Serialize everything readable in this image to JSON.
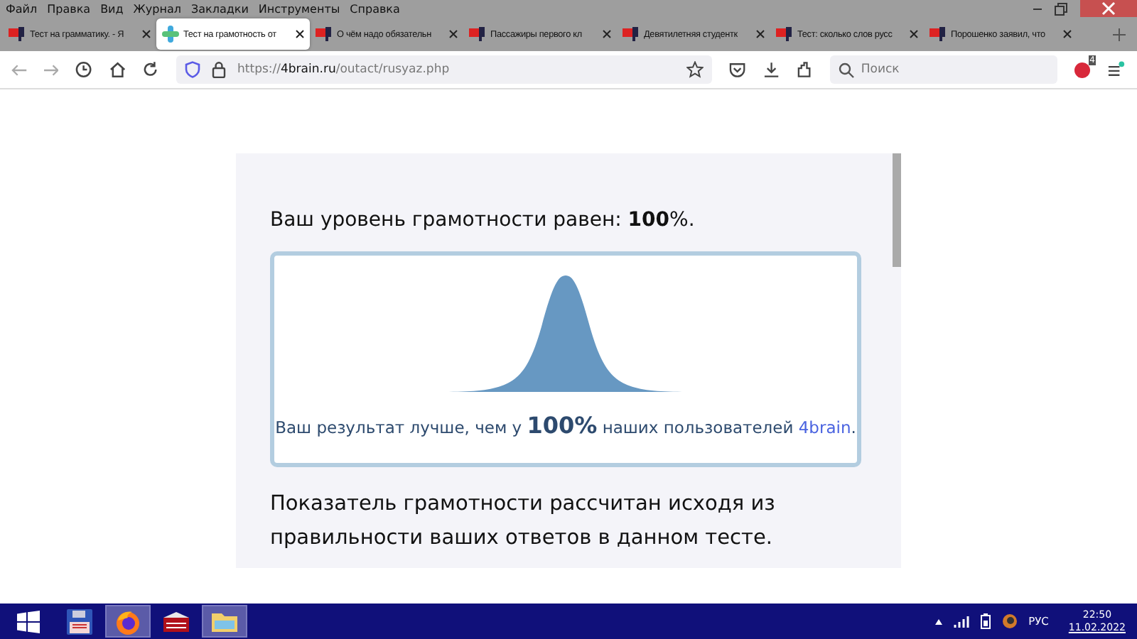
{
  "menu_bar": [
    "Файл",
    "Правка",
    "Вид",
    "Журнал",
    "Закладки",
    "Инструменты",
    "Справка"
  ],
  "tabs": [
    {
      "title": "Тест на грамматику. - Я",
      "selected": false,
      "kind": "site"
    },
    {
      "title": "Тест на грамотность от",
      "selected": true,
      "kind": "brain"
    },
    {
      "title": "О чём надо обязательн",
      "selected": false,
      "kind": "site"
    },
    {
      "title": "Пассажиры первого кл",
      "selected": false,
      "kind": "site"
    },
    {
      "title": "Девятилетняя студентк",
      "selected": false,
      "kind": "site"
    },
    {
      "title": "Тест: сколько слов русс",
      "selected": false,
      "kind": "site"
    },
    {
      "title": "Порошенко заявил, что",
      "selected": false,
      "kind": "site"
    }
  ],
  "address_bar": {
    "scheme": "https://",
    "domain": "4brain.ru",
    "path": "/outact/rusyaz.php"
  },
  "search": {
    "placeholder": "Поиск"
  },
  "extension_badge": "4",
  "page": {
    "heading": "Ваш уровень грамотности равен: **100**%.",
    "result": {
      "before": "Ваш результат лучше, чем у ",
      "value": "100%",
      "after": " наших пользователей ",
      "link": "4brain",
      "end": "."
    },
    "note": "Показатель грамотности рассчитан исходя из правильности ваших ответов в данном тесте."
  },
  "taskbar": {
    "apps": [
      {
        "kind": "save",
        "selected": false
      },
      {
        "kind": "firefox",
        "selected": true
      },
      {
        "kind": "books",
        "selected": false
      },
      {
        "kind": "folder",
        "selected": true
      }
    ],
    "language": "РУС",
    "time": "22:50",
    "date": "11.02.2022"
  }
}
